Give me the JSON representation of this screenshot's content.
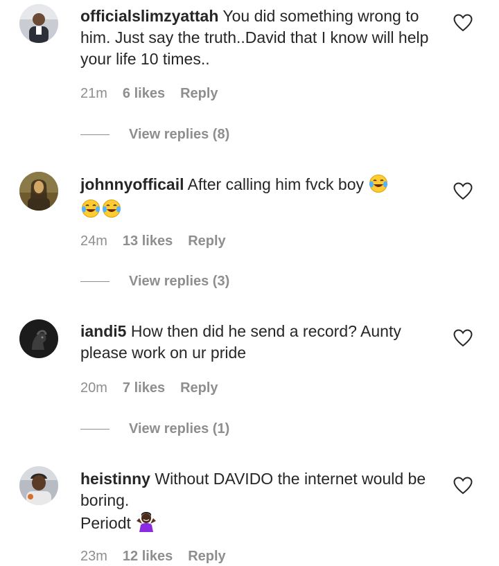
{
  "comments": [
    {
      "username": "officialslimzyattah",
      "text": "You did something wrong to him. Just say the truth..David that I know will help your life 10 times..",
      "time": "21m",
      "likes": "6 likes",
      "reply_label": "Reply",
      "view_replies": "View replies (8)"
    },
    {
      "username": "johnnyofficail",
      "text": "After calling him fvck boy",
      "time": "24m",
      "likes": "13 likes",
      "reply_label": "Reply",
      "view_replies": "View replies (3)"
    },
    {
      "username": "iandi5",
      "text": "How then did he send a record? Aunty please work on ur pride",
      "time": "20m",
      "likes": "7 likes",
      "reply_label": "Reply",
      "view_replies": "View replies (1)"
    },
    {
      "username": "heistinny",
      "text": "Without DAVIDO the internet would be boring.",
      "text_line2": "Periodt",
      "time": "23m",
      "likes": "12 likes",
      "reply_label": "Reply"
    }
  ],
  "icons": {
    "like": "heart-outline-icon",
    "laughing_emoji": "face-with-tears-of-joy-emoji",
    "shrug_emoji": "person-shrugging-emoji"
  },
  "colors": {
    "text": "#262626",
    "secondary": "#8e8e8e",
    "background": "#ffffff"
  }
}
